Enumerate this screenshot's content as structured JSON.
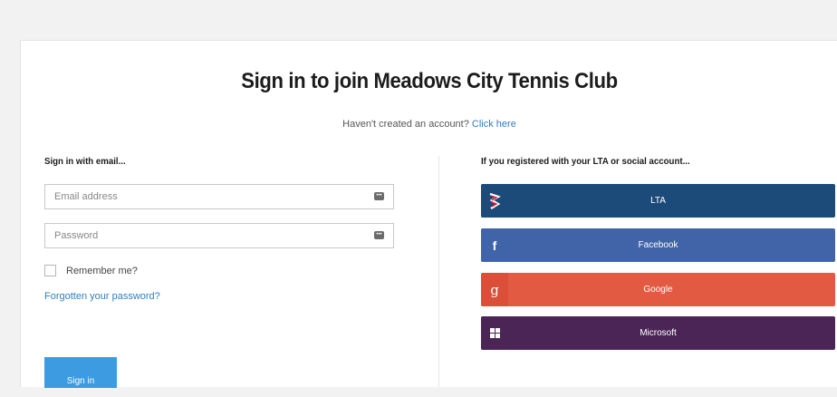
{
  "page": {
    "title": "Sign in to join Meadows City Tennis Club",
    "no_account_text": "Haven't created an account?",
    "click_here": "Click here"
  },
  "email_section": {
    "heading": "Sign in with email...",
    "email_placeholder": "Email address",
    "password_placeholder": "Password",
    "remember_label": "Remember me?",
    "forgot_link": "Forgotten your password?",
    "sign_in_label": "Sign in"
  },
  "social_section": {
    "heading": "If you registered with your LTA or social account...",
    "providers": [
      {
        "label": "LTA",
        "icon": "lta-logo-icon",
        "color": "#1c4a79"
      },
      {
        "label": "Facebook",
        "icon": "facebook-icon",
        "glyph": "f",
        "color": "#4163a8"
      },
      {
        "label": "Google",
        "icon": "google-icon",
        "glyph": "g",
        "color": "#e35a42"
      },
      {
        "label": "Microsoft",
        "icon": "windows-icon",
        "color": "#4a2556"
      }
    ]
  }
}
